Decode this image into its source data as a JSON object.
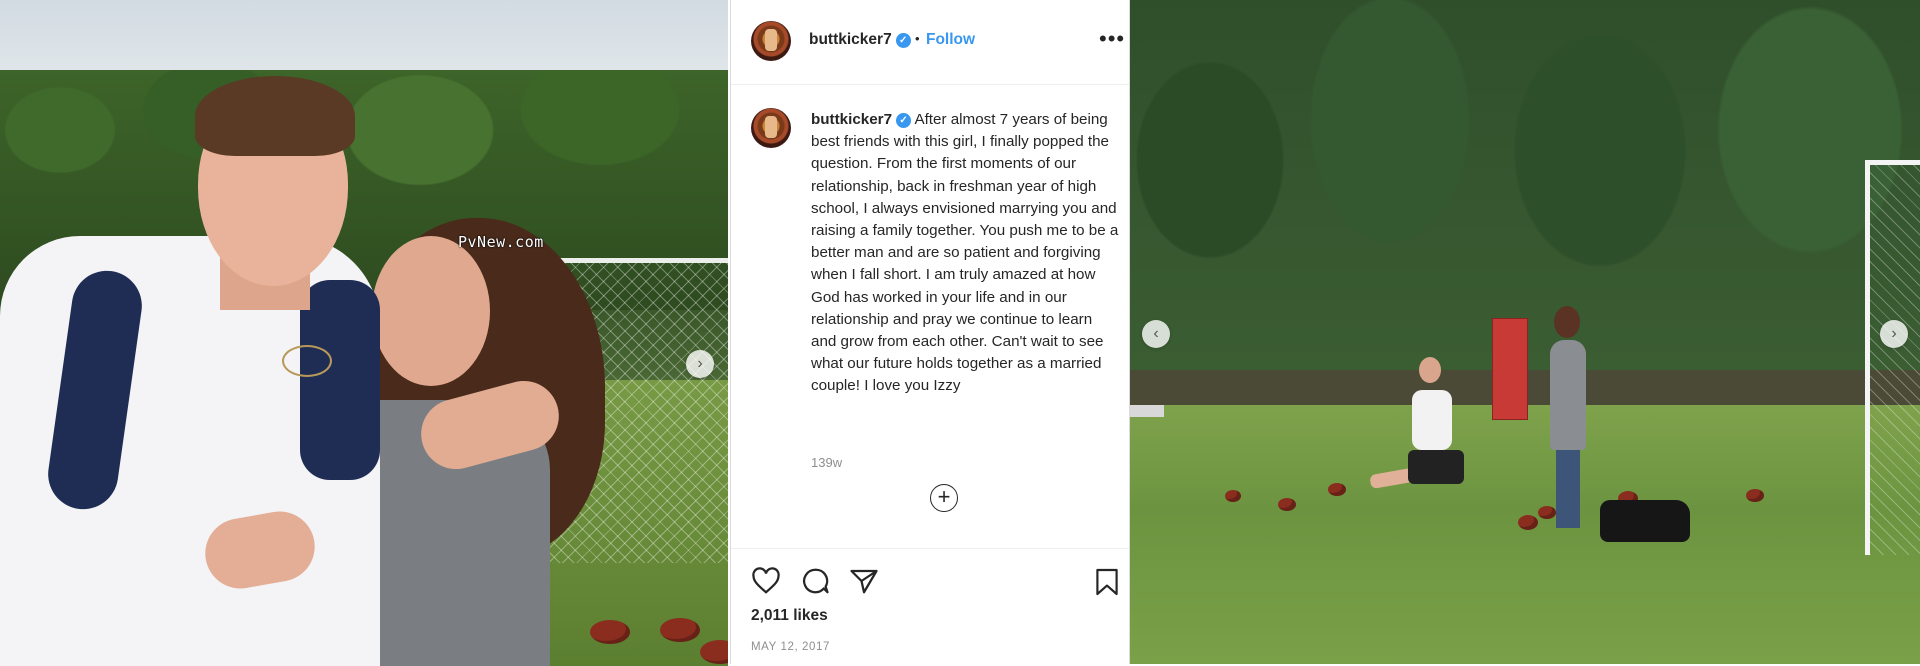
{
  "watermark": "PvNew.com",
  "post": {
    "username": "buttkicker7",
    "verified_icon": "verified-badge-icon",
    "separator": "•",
    "follow_label": "Follow",
    "more_icon": "•••",
    "caption": "After almost 7 years of being best friends with this girl, I finally popped the question. From the first moments of our relationship, back in freshman year of high school, I always envisioned marrying you and raising a family together. You push me to be a better man and are so patient and forgiving when I fall short. I am truly amazed at how God has worked in your life and in our relationship and pray we continue to learn and grow from each other. Can't wait to see what our future holds together as a married couple! I love you Izzy",
    "time_ago": "139w",
    "load_more_icon": "+",
    "likes": "2,011 likes",
    "date": "MAY 12, 2017"
  },
  "icons": {
    "like": "heart-icon",
    "comment": "comment-icon",
    "share": "paper-plane-icon",
    "save": "bookmark-icon"
  },
  "carousel": {
    "left_photo_next": "›",
    "right_photo_prev": "‹",
    "right_photo_next": "›"
  },
  "colors": {
    "link_blue": "#3897f0",
    "text_primary": "#262626",
    "text_secondary": "#8e8e8e"
  }
}
